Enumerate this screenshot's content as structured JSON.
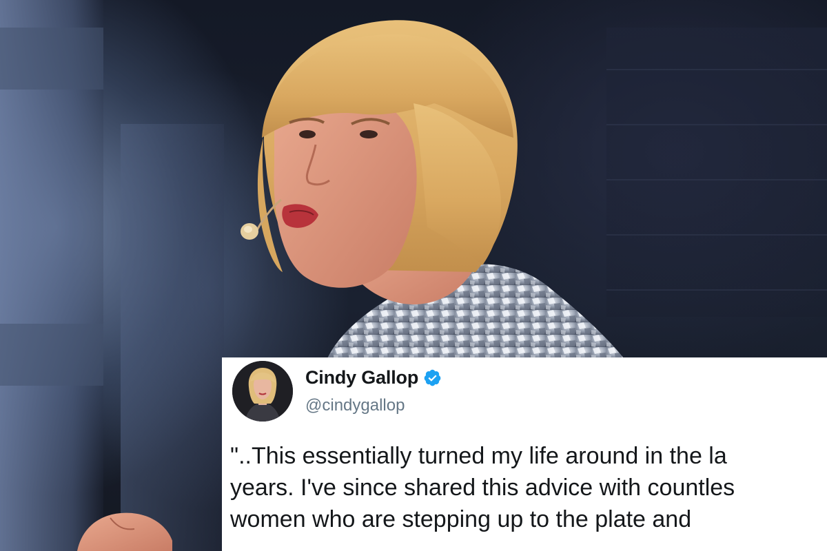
{
  "tweet": {
    "display_name": "Cindy Gallop",
    "handle": "@cindygallop",
    "verified": true,
    "text_lines": [
      "\"..This essentially turned my life around in the la",
      "years. I've since shared this advice with countles",
      "women who are stepping up to the plate and"
    ]
  },
  "colors": {
    "verified_badge": "#1da1f2",
    "handle": "#657786",
    "text": "#14171a",
    "card_background": "#ffffff"
  },
  "icons": {
    "verified": "verified-badge-icon"
  }
}
